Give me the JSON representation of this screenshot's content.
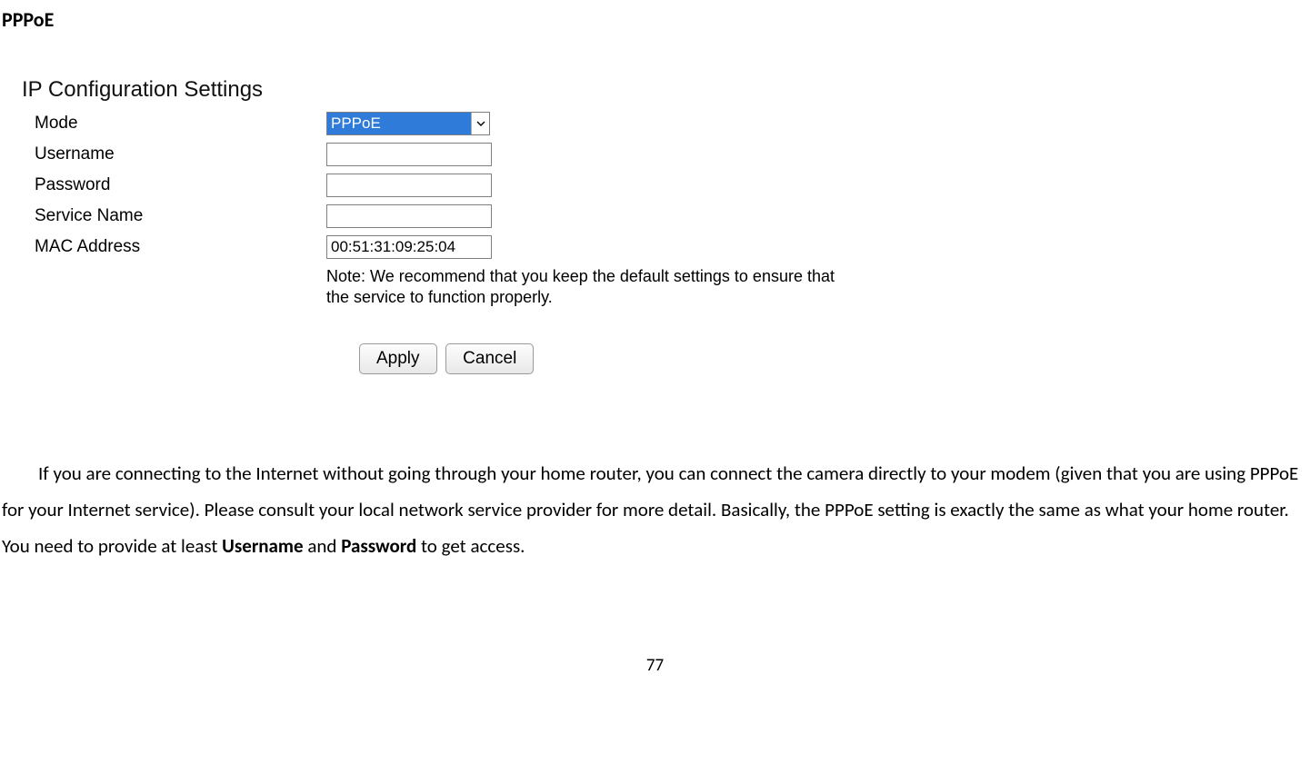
{
  "title": "PPPoE",
  "panel": {
    "heading": "IP Configuration Settings",
    "rows": {
      "mode": {
        "label": "Mode",
        "value": "PPPoE"
      },
      "username": {
        "label": "Username",
        "value": ""
      },
      "password": {
        "label": "Password",
        "value": ""
      },
      "service_name": {
        "label": "Service Name",
        "value": ""
      },
      "mac": {
        "label": "MAC Address",
        "value": "00:51:31:09:25:04"
      }
    },
    "note": "Note: We recommend that you keep the default settings to ensure that the service to function properly.",
    "apply": "Apply",
    "cancel": "Cancel"
  },
  "body": {
    "p1_a": "If you are connecting to the Internet without going through your home router, you can connect the camera directly to your modem (given that you are using PPPoE for your Internet service). Please consult your local network service provider for more detail. Basically, the PPPoE setting is exactly the same as what your home router. You need to provide at least ",
    "p1_b": "Username",
    "p1_c": " and ",
    "p1_d": "Password",
    "p1_e": " to get access."
  },
  "page_number": "77"
}
